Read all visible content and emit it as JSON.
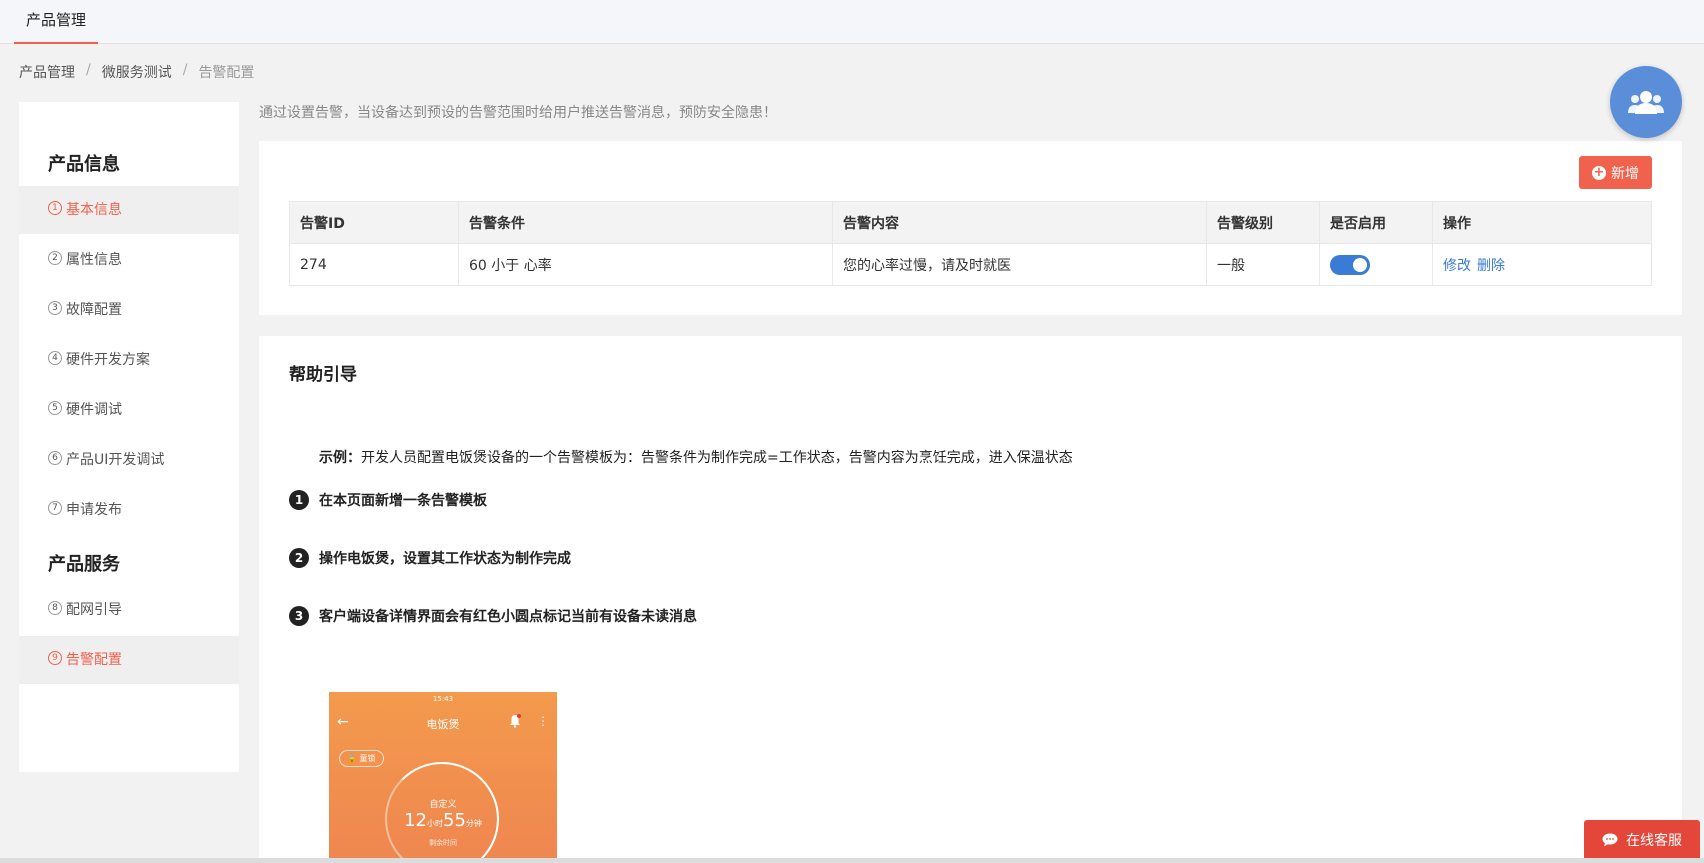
{
  "topbar": {
    "tab_label": "产品管理"
  },
  "breadcrumb": {
    "items": [
      "产品管理",
      "微服务测试",
      "告警配置"
    ],
    "separator": "/"
  },
  "sidebar": {
    "section1_title": "产品信息",
    "section2_title": "产品服务",
    "items": [
      {
        "num": "1",
        "label": "基本信息"
      },
      {
        "num": "2",
        "label": "属性信息"
      },
      {
        "num": "3",
        "label": "故障配置"
      },
      {
        "num": "4",
        "label": "硬件开发方案"
      },
      {
        "num": "5",
        "label": "硬件调试"
      },
      {
        "num": "6",
        "label": "产品UI开发调试"
      },
      {
        "num": "7",
        "label": "申请发布"
      },
      {
        "num": "8",
        "label": "配网引导"
      },
      {
        "num": "9",
        "label": "告警配置"
      }
    ]
  },
  "tip": "通过设置告警，当设备达到预设的告警范围时给用户推送告警消息，预防安全隐患！",
  "alarm_card": {
    "add_label": "新增",
    "columns": [
      "告警ID",
      "告警条件",
      "告警内容",
      "告警级别",
      "是否启用",
      "操作"
    ],
    "rows": [
      {
        "id": "274",
        "condition": "60 小于 心率",
        "content": "您的心率过慢，请及时就医",
        "level": "一般",
        "enabled": true,
        "edit": "修改",
        "delete": "删除"
      }
    ]
  },
  "help": {
    "title": "帮助引导",
    "example_label": "示例：",
    "example_text": "开发人员配置电饭煲设备的一个告警模板为：告警条件为制作完成=工作状态，告警内容为烹饪完成，进入保温状态",
    "steps": [
      {
        "num": "1",
        "text": "在本页面新增一条告警模板"
      },
      {
        "num": "2",
        "text": "操作电饭煲，设置其工作状态为制作完成"
      },
      {
        "num": "3",
        "text": "客户端设备详情界面会有红色小圆点标记当前有设备未读消息"
      }
    ],
    "phone": {
      "status_time": "15:43",
      "title": "电饭煲",
      "lock_label": "童锁",
      "mode": "自定义",
      "hours": "12",
      "hours_unit": "小时",
      "minutes": "55",
      "minutes_unit": "分钟",
      "remain_label": "剩余时间"
    }
  },
  "service_button": {
    "label": "在线客服"
  },
  "colors": {
    "accent": "#f0624d",
    "link": "#3a7bd5",
    "avatar": "#5b8ed9",
    "service": "#e5463a"
  }
}
